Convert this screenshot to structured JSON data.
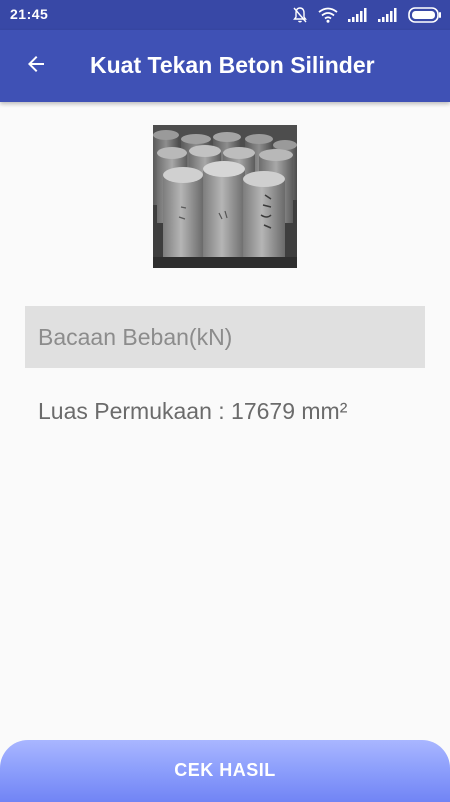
{
  "status_bar": {
    "time": "21:45",
    "icons": [
      "notifications-off-icon",
      "wifi-icon",
      "signal-icon",
      "signal-icon",
      "battery-icon"
    ]
  },
  "app_bar": {
    "back_icon": "arrow-left-icon",
    "title": "Kuat Tekan Beton Silinder"
  },
  "form": {
    "load_input": {
      "placeholder": "Bacaan Beban(kN)",
      "value": ""
    },
    "area_text": "Luas Permukaan : 17679 mm²"
  },
  "actions": {
    "check_button_label": "CEK HASIL"
  },
  "colors": {
    "primary": "#3f51b5",
    "primary_dark": "#3848a6",
    "button_gradient_top": "#a9b6ff",
    "button_gradient_bottom": "#7184f5",
    "input_background": "#e0e0e0"
  }
}
